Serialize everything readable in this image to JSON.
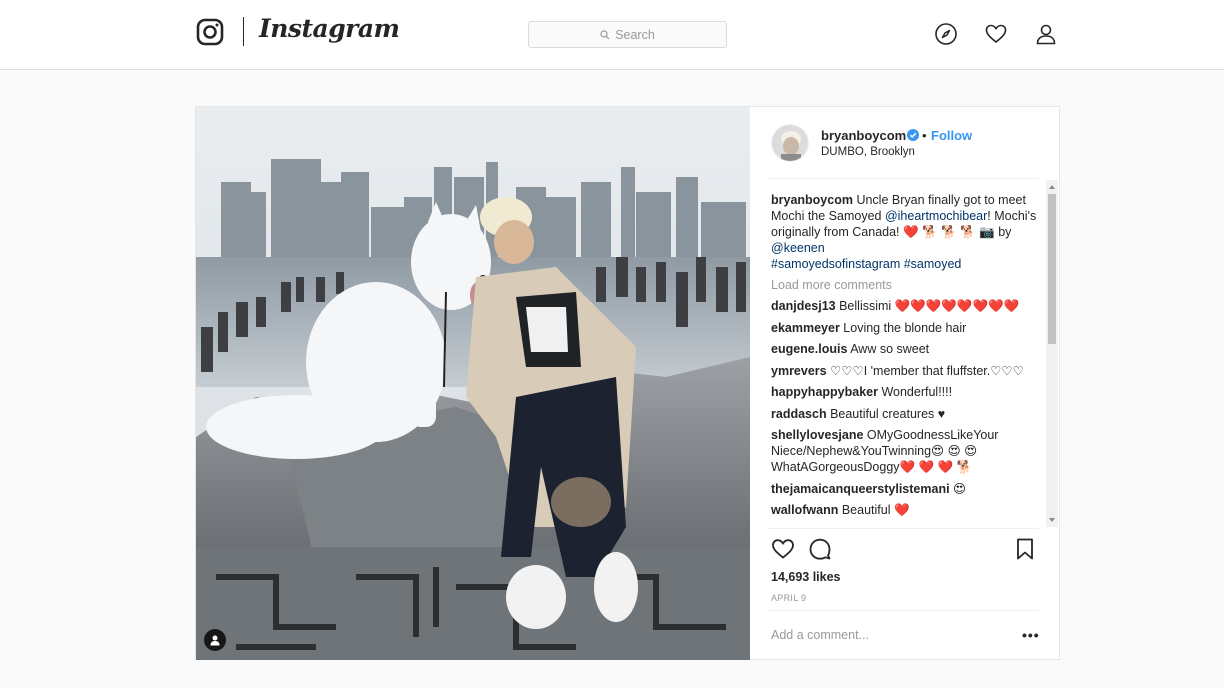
{
  "app": {
    "wordmark": "Instagram"
  },
  "search": {
    "placeholder": "Search"
  },
  "post": {
    "username": "bryanboycom",
    "follow_label": "Follow",
    "separator": "•",
    "location": "DUMBO, Brooklyn",
    "caption": {
      "user": "bryanboycom",
      "text1": " Uncle Bryan finally got to meet Mochi the Samoyed ",
      "mention1": "@iheartmochibear",
      "text2": "! Mochi's originally from Canada! ❤️ 🐕 🐕 🐕 📷 by ",
      "mention2": "@keenen",
      "hashtags": "#samoyedsofinstagram #samoyed"
    },
    "load_more": "Load more comments",
    "comments": [
      {
        "user": "danjdesj13",
        "text": " Bellissimi ❤️❤️❤️❤️❤️❤️❤️❤️"
      },
      {
        "user": "ekammeyer",
        "text": " Loving the blonde hair"
      },
      {
        "user": "eugene.louis",
        "text": " Aww so sweet"
      },
      {
        "user": "ymrevers",
        "text": " ♡♡♡I 'member that fluffster.♡♡♡"
      },
      {
        "user": "happyhappybaker",
        "text": " Wonderful!!!!"
      },
      {
        "user": "raddasch",
        "text": " Beautiful creatures ♥"
      },
      {
        "user": "shellylovesjane",
        "text": " OMyGoodnessLikeYour Niece/Nephew&YouTwinning😍 😍 😍 WhatAGorgeousDoggy❤️ ❤️ ❤️ 🐕"
      },
      {
        "user": "thejamaicanqueerstylistemani",
        "text": " 😍"
      },
      {
        "user": "wallofwann",
        "text": " Beautiful ❤️"
      }
    ],
    "likes": "14,693 likes",
    "date": "APRIL 9",
    "add_comment_placeholder": "Add a comment...",
    "more_label": "•••"
  },
  "colors": {
    "link": "#3897f0",
    "mention": "#003569",
    "muted": "#999999",
    "text": "#262626"
  },
  "icons": [
    "instagram-logo-icon",
    "search-icon",
    "explore-compass-icon",
    "activity-heart-icon",
    "profile-icon",
    "verified-badge-icon",
    "like-heart-icon",
    "comment-icon",
    "save-bookmark-icon",
    "user-tag-icon"
  ]
}
